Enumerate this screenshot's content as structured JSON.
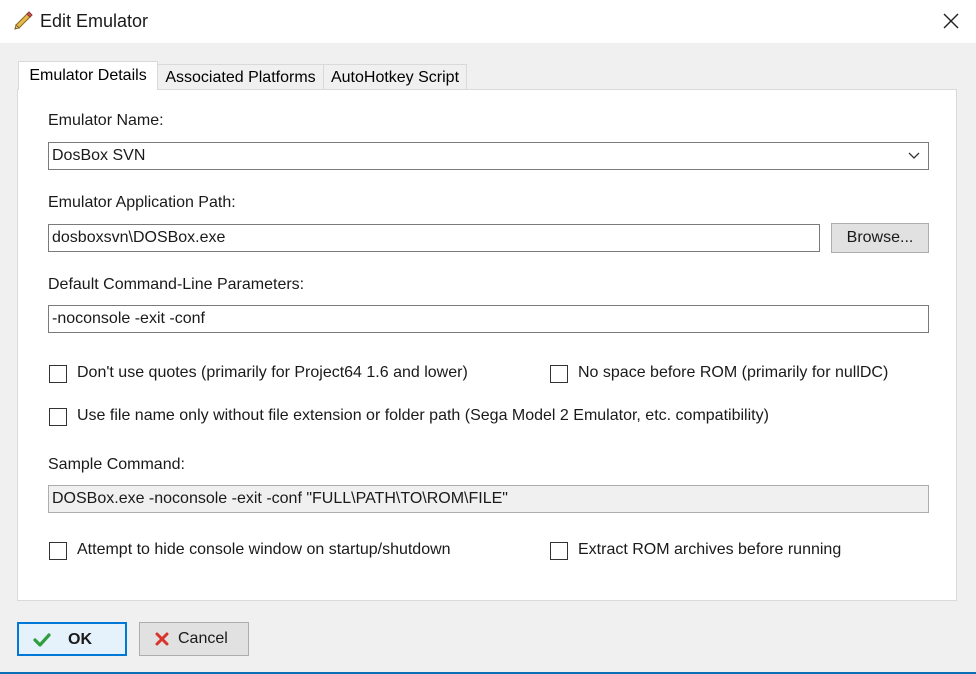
{
  "window": {
    "title": "Edit Emulator",
    "title_icon": "pencil-icon",
    "close_icon": "close-icon"
  },
  "tabs": [
    {
      "label": "Emulator Details",
      "active": true
    },
    {
      "label": "Associated Platforms",
      "active": false
    },
    {
      "label": "AutoHotkey Script",
      "active": false
    }
  ],
  "form": {
    "emulator_name_label": "Emulator Name:",
    "emulator_name_value": "DosBox SVN",
    "app_path_label": "Emulator Application Path:",
    "app_path_value": "dosboxsvn\\DOSBox.exe",
    "browse_label": "Browse...",
    "params_label": "Default Command-Line Parameters:",
    "params_value": "-noconsole -exit -conf",
    "sample_label": "Sample Command:",
    "sample_value": "DOSBox.exe -noconsole -exit -conf \"FULL\\PATH\\TO\\ROM\\FILE\""
  },
  "checkboxes": {
    "no_quotes": {
      "label": "Don't use quotes (primarily for Project64 1.6 and lower)",
      "checked": false
    },
    "no_space": {
      "label": "No space before ROM (primarily for nullDC)",
      "checked": false
    },
    "file_name_only": {
      "label": "Use file name only without file extension or folder path (Sega Model 2 Emulator, etc. compatibility)",
      "checked": false
    },
    "hide_console": {
      "label": "Attempt to hide console window on startup/shutdown",
      "checked": false
    },
    "extract_rom": {
      "label": "Extract ROM archives before running",
      "checked": false
    }
  },
  "buttons": {
    "ok_label": "OK",
    "cancel_label": "Cancel",
    "ok_icon": "checkmark-icon",
    "cancel_icon": "cross-icon",
    "ok_icon_color": "#2e9e3e",
    "cancel_icon_color": "#d9342b"
  }
}
